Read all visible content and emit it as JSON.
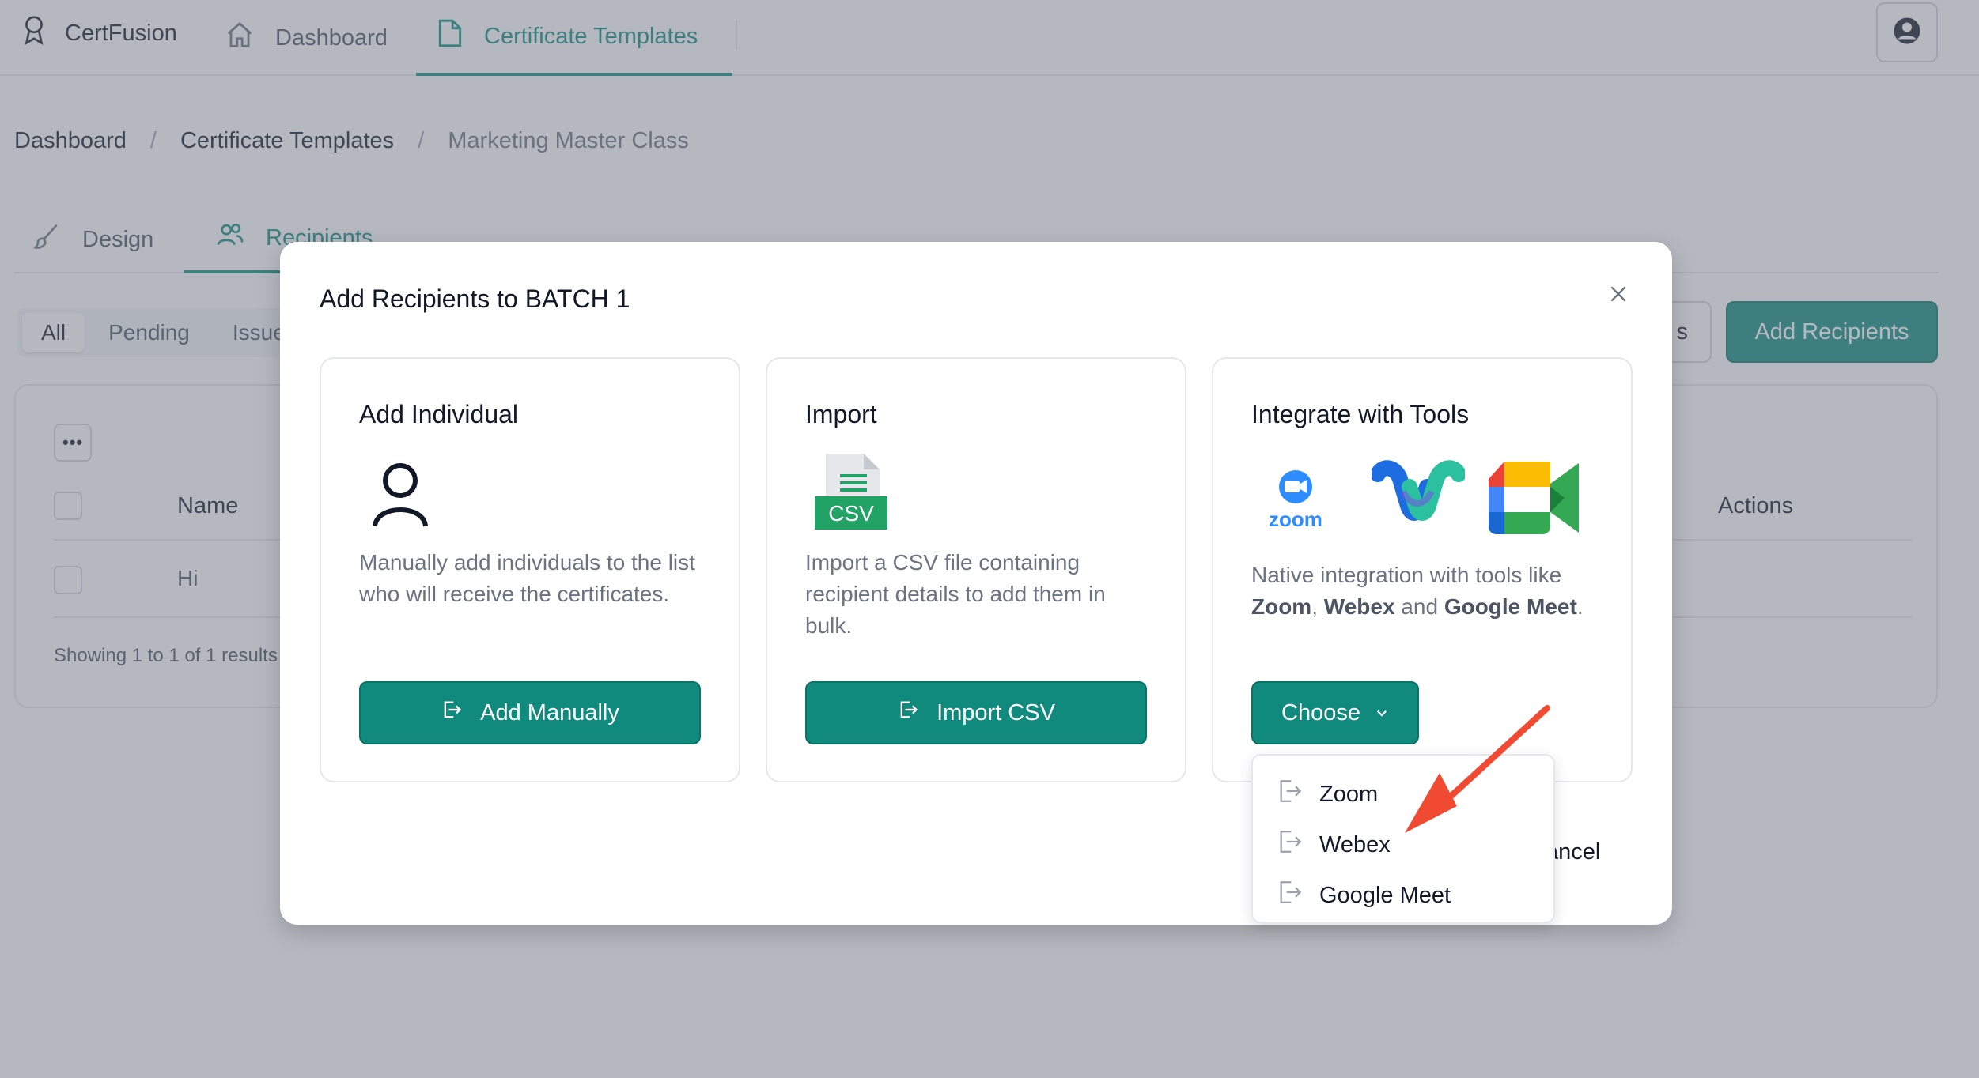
{
  "app": {
    "brand": "CertFusion",
    "nav": [
      {
        "label": "Dashboard"
      },
      {
        "label": "Certificate Templates"
      }
    ]
  },
  "breadcrumb": [
    "Dashboard",
    "Certificate Templates",
    "Marketing Master Class"
  ],
  "subtabs": [
    "Design",
    "Recipients"
  ],
  "filters": [
    "All",
    "Pending",
    "Issue"
  ],
  "toolbar": {
    "partial_button_text": "s",
    "add_recipients": "Add Recipients"
  },
  "table": {
    "columns": {
      "name": "Name",
      "actions": "Actions"
    },
    "rows": [
      {
        "name": "Hi"
      }
    ],
    "footer": "Showing 1 to 1 of 1 results"
  },
  "modal": {
    "title": "Add Recipients to BATCH 1",
    "options": [
      {
        "title": "Add Individual",
        "description": "Manually add individuals to the list who will receive the certificates.",
        "button": "Add Manually"
      },
      {
        "title": "Import",
        "icon_label": "CSV",
        "description": "Import a CSV file containing recipient details to add them in bulk.",
        "button": "Import CSV"
      },
      {
        "title": "Integrate with Tools",
        "description_parts": [
          "Native integration with tools like ",
          "Zoom",
          ", ",
          "Webex",
          " and ",
          "Google Meet",
          "."
        ],
        "logo_zoom_text": "zoom",
        "button": "Choose"
      }
    ],
    "cancel_partial": "ancel",
    "dropdown": [
      "Zoom",
      "Webex",
      "Google Meet"
    ]
  },
  "colors": {
    "accent": "#0f8a7d",
    "arrow": "#f04a32",
    "zoom_blue": "#2d8cff",
    "csv_green": "#21a366"
  }
}
